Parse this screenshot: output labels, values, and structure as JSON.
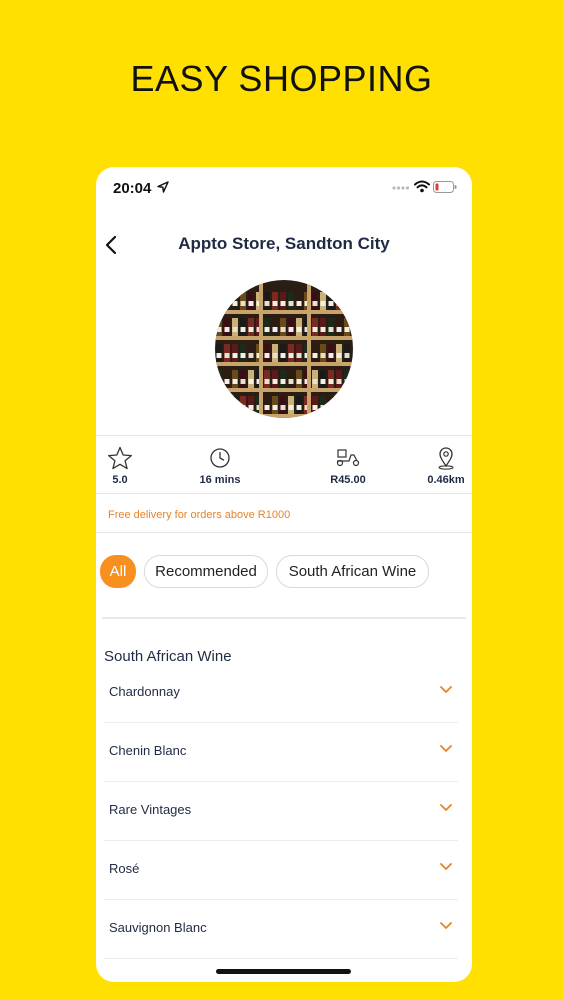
{
  "promo_headline": "EASY SHOPPING",
  "status_bar": {
    "time": "20:04"
  },
  "header": {
    "title": "Appto Store, Sandton City"
  },
  "stats": [
    {
      "icon": "star-icon",
      "value": "5.0"
    },
    {
      "icon": "clock-icon",
      "value": "16  mins"
    },
    {
      "icon": "scooter-icon",
      "value": "R45.00"
    },
    {
      "icon": "location-pin-icon",
      "value": "0.46km"
    }
  ],
  "promo_banner": "Free delivery for orders above R1000",
  "filters": [
    {
      "label": "All",
      "active": true
    },
    {
      "label": "Recommended",
      "active": false
    },
    {
      "label": "South African Wine",
      "active": false
    }
  ],
  "section": {
    "title": "South African Wine",
    "categories": [
      "Chardonnay",
      "Chenin Blanc",
      "Rare Vintages",
      "Rosé",
      "Sauvignon Blanc"
    ]
  },
  "colors": {
    "background": "#FFE000",
    "accent": "#F7901E",
    "promo_text": "#E8832A",
    "title_text": "#1f2a44"
  }
}
